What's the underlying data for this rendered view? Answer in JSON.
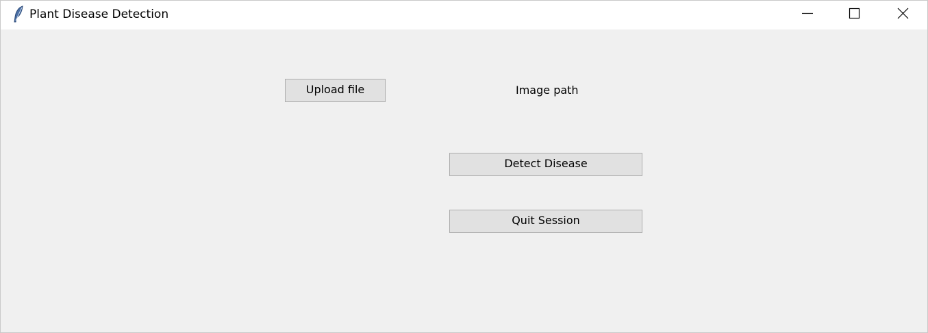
{
  "window": {
    "title": "Plant Disease Detection",
    "app_icon": "feather-icon",
    "controls": {
      "minimize_icon": "minimize-icon",
      "maximize_icon": "maximize-icon",
      "close_icon": "close-icon"
    }
  },
  "main": {
    "upload_button_label": "Upload file",
    "image_path_label": "Image path",
    "detect_button_label": "Detect Disease",
    "quit_button_label": "Quit Session"
  },
  "colors": {
    "background": "#f0f0f0",
    "titlebar": "#ffffff",
    "button_face": "#e1e1e1",
    "button_border": "#adadad"
  }
}
